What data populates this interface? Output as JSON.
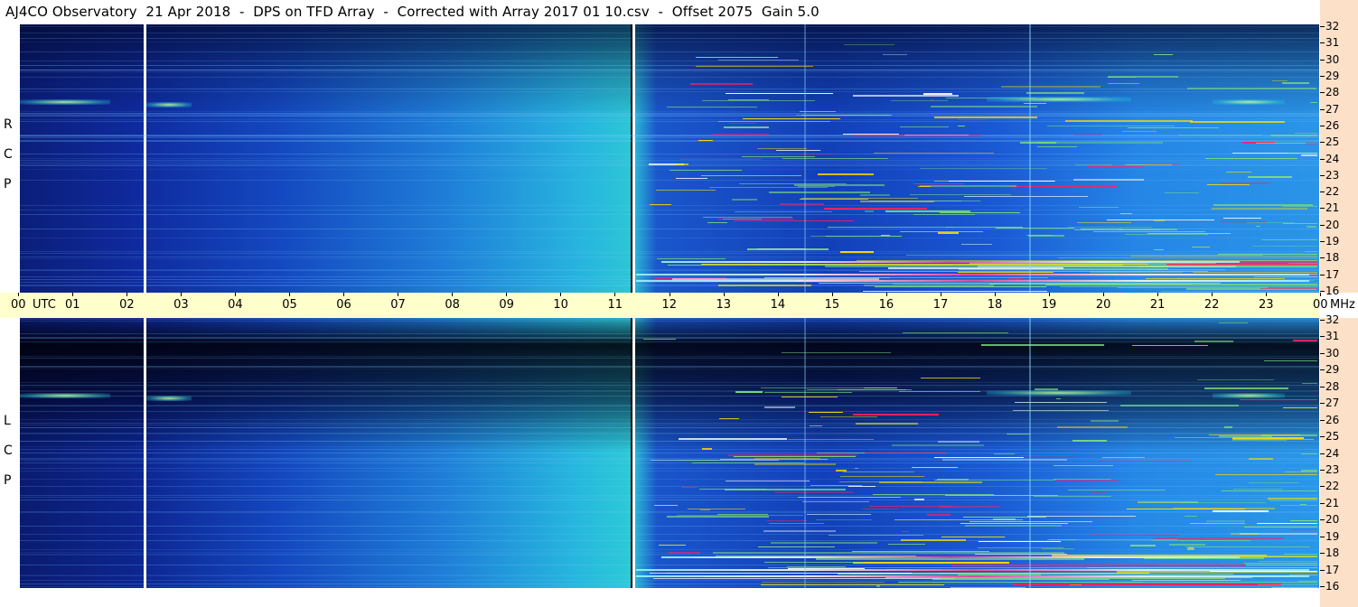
{
  "title": "AJ4CO Observatory  21 Apr 2018  -  DPS on TFD Array  -  Corrected with Array 2017 01 10.csv  -  Offset 2075  Gain 5.0",
  "chart_data": [
    {
      "type": "heatmap",
      "panel": "RCP",
      "polarization_label": [
        "R",
        "C",
        "P"
      ],
      "x_unit": "UTC",
      "y_unit": "MHz",
      "x_ticks": [
        "00",
        "01",
        "02",
        "03",
        "04",
        "05",
        "06",
        "07",
        "08",
        "09",
        "10",
        "11",
        "12",
        "13",
        "14",
        "15",
        "16",
        "17",
        "18",
        "19",
        "20",
        "21",
        "22",
        "23",
        "00"
      ],
      "y_ticks": [
        "32",
        "31",
        "30",
        "29",
        "28",
        "27",
        "26",
        "25",
        "24",
        "23",
        "22",
        "21",
        "20",
        "19",
        "18",
        "17",
        "16"
      ],
      "y_range": [
        16,
        32
      ],
      "x_range_hours": [
        0,
        24
      ],
      "colormap": [
        "#000820",
        "#0b2a9e",
        "#1f7fd8",
        "#2cc6d6",
        "#7fe07a",
        "#ffe000",
        "#ff2060",
        "#ffffff"
      ]
    },
    {
      "type": "heatmap",
      "panel": "LCP",
      "polarization_label": [
        "L",
        "C",
        "P"
      ],
      "x_unit": "UTC",
      "y_unit": "MHz",
      "x_ticks": [
        "00",
        "01",
        "02",
        "03",
        "04",
        "05",
        "06",
        "07",
        "08",
        "09",
        "10",
        "11",
        "12",
        "13",
        "14",
        "15",
        "16",
        "17",
        "18",
        "19",
        "20",
        "21",
        "22",
        "23",
        "00"
      ],
      "y_ticks": [
        "32",
        "31",
        "30",
        "29",
        "28",
        "27",
        "26",
        "25",
        "24",
        "23",
        "22",
        "21",
        "20",
        "19",
        "18",
        "17",
        "16"
      ],
      "y_range": [
        16,
        32
      ],
      "x_range_hours": [
        0,
        24
      ],
      "colormap": [
        "#000820",
        "#0b2a9e",
        "#1f7fd8",
        "#2cc6d6",
        "#7fe07a",
        "#ffe000",
        "#ff2060",
        "#ffffff"
      ]
    }
  ],
  "axis": {
    "utc_label": "UTC",
    "mhz_label": "MHz"
  }
}
